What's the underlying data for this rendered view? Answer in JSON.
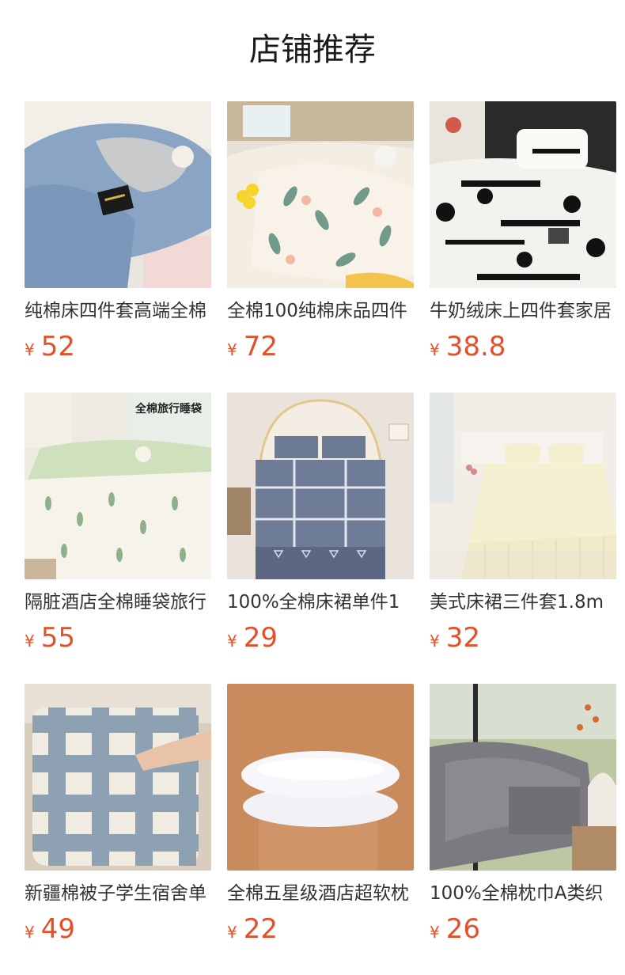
{
  "page": {
    "title": "店铺推荐"
  },
  "accent_color": "#e4502a",
  "products": [
    {
      "name": "纯棉床四件套高端全棉",
      "currency": "¥",
      "price": "52",
      "image": "blue-duvet-set"
    },
    {
      "name": "全棉100纯棉床品四件",
      "currency": "¥",
      "price": "72",
      "image": "floral-duvet-set"
    },
    {
      "name": "牛奶绒床上四件套家居",
      "currency": "¥",
      "price": "38.8",
      "image": "puppy-dog-print-set"
    },
    {
      "name": "隔脏酒店全棉睡袋旅行",
      "currency": "¥",
      "price": "55",
      "image": "green-travel-sleeping-bag",
      "overlay": "全棉旅行睡袋"
    },
    {
      "name": "100%全棉床裙单件1",
      "currency": "¥",
      "price": "29",
      "image": "grey-plaid-bed-skirt"
    },
    {
      "name": "美式床裙三件套1.8m",
      "currency": "¥",
      "price": "32",
      "image": "cream-ruffle-bed-skirt"
    },
    {
      "name": "新疆棉被子学生宿舍单",
      "currency": "¥",
      "price": "49",
      "image": "blue-check-quilt"
    },
    {
      "name": "全棉五星级酒店超软枕",
      "currency": "¥",
      "price": "22",
      "image": "white-pillows"
    },
    {
      "name": "100%全棉枕巾A类织",
      "currency": "¥",
      "price": "26",
      "image": "grey-towel-blanket"
    }
  ]
}
